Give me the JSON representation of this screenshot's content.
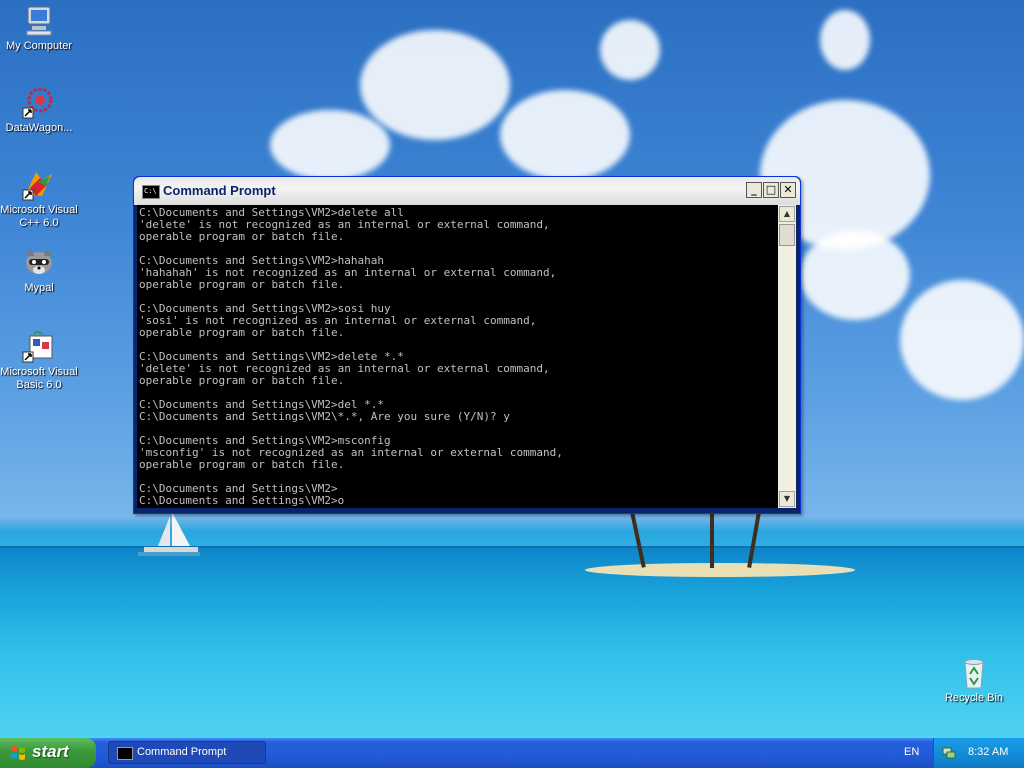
{
  "desktop": {
    "icons": [
      {
        "label": "My Computer"
      },
      {
        "label": "DataWagon..."
      },
      {
        "label": "Microsoft Visual C++ 6.0"
      },
      {
        "label": "Mypal"
      },
      {
        "label": "Microsoft Visual Basic 6.0"
      },
      {
        "label": "Recycle Bin"
      }
    ]
  },
  "window": {
    "title": "Command Prompt",
    "icon_text": "C:\\",
    "controls": {
      "minimize": "_",
      "maximize": "□",
      "close": "✕"
    },
    "console_lines": [
      "C:\\Documents and Settings\\VM2>delete all",
      "'delete' is not recognized as an internal or external command,",
      "operable program or batch file.",
      "",
      "C:\\Documents and Settings\\VM2>hahahah",
      "'hahahah' is not recognized as an internal or external command,",
      "operable program or batch file.",
      "",
      "C:\\Documents and Settings\\VM2>sosi huy",
      "'sosi' is not recognized as an internal or external command,",
      "operable program or batch file.",
      "",
      "C:\\Documents and Settings\\VM2>delete *.*",
      "'delete' is not recognized as an internal or external command,",
      "operable program or batch file.",
      "",
      "C:\\Documents and Settings\\VM2>del *.*",
      "C:\\Documents and Settings\\VM2\\*.*, Are you sure (Y/N)? y",
      "",
      "C:\\Documents and Settings\\VM2>msconfig",
      "'msconfig' is not recognized as an internal or external command,",
      "operable program or batch file.",
      "",
      "C:\\Documents and Settings\\VM2>",
      "C:\\Documents and Settings\\VM2>o"
    ]
  },
  "taskbar": {
    "start_label": "start",
    "tasks": [
      {
        "label": "Command Prompt"
      }
    ],
    "language": "EN",
    "clock": "8:32 AM"
  },
  "colors": {
    "taskbar_blue": "#245edb",
    "start_green": "#3c9a3c",
    "console_text": "#c0c0c0",
    "console_bg": "#000000"
  }
}
